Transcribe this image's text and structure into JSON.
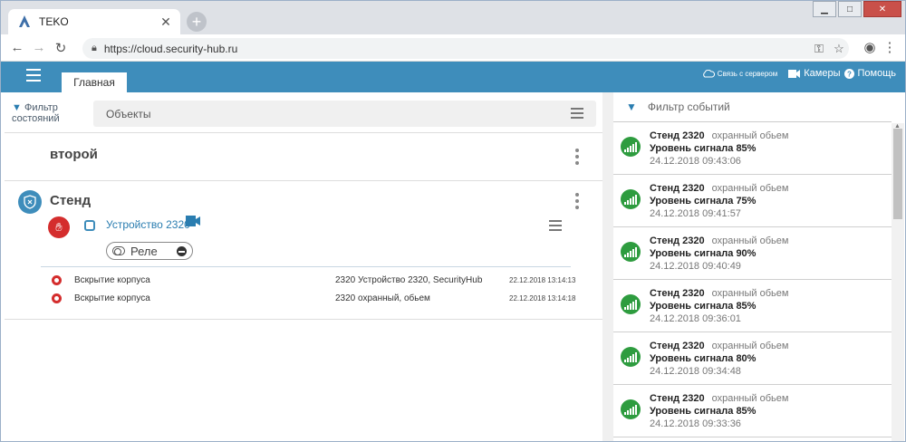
{
  "browser": {
    "tab_title": "TEKO",
    "url": "https://cloud.security-hub.ru"
  },
  "header": {
    "main_tab": "Главная",
    "sync_label": "Связь с сервером",
    "cameras_label": "Камеры",
    "help_label": "Помощь"
  },
  "left": {
    "filter_state_line1": "Фильтр",
    "filter_state_line2": "состояний",
    "objects_placeholder": "Объекты",
    "object1_name": "второй",
    "object2_name": "Стенд",
    "device_name": "Устройство 2320",
    "relay_label": "Реле",
    "events": [
      {
        "text": "Вскрытие корпуса",
        "source": "2320 Устройство 2320, SecurityHub",
        "datetime": "22.12.2018 13:14:13"
      },
      {
        "text": "Вскрытие корпуса",
        "source": "2320 охранный, обьем",
        "datetime": "22.12.2018 13:14:18"
      }
    ]
  },
  "right": {
    "filter_placeholder": "Фильтр событий",
    "events": [
      {
        "device": "Стенд 2320",
        "zone": "охранный обьем",
        "message": "Уровень сигнала 85%",
        "datetime": "24.12.2018 09:43:06"
      },
      {
        "device": "Стенд 2320",
        "zone": "охранный обьем",
        "message": "Уровень сигнала 75%",
        "datetime": "24.12.2018 09:41:57"
      },
      {
        "device": "Стенд 2320",
        "zone": "охранный обьем",
        "message": "Уровень сигнала 90%",
        "datetime": "24.12.2018 09:40:49"
      },
      {
        "device": "Стенд 2320",
        "zone": "охранный обьем",
        "message": "Уровень сигнала 85%",
        "datetime": "24.12.2018 09:36:01"
      },
      {
        "device": "Стенд 2320",
        "zone": "охранный обьем",
        "message": "Уровень сигнала 80%",
        "datetime": "24.12.2018 09:34:48"
      },
      {
        "device": "Стенд 2320",
        "zone": "охранный обьем",
        "message": "Уровень сигнала 85%",
        "datetime": "24.12.2018 09:33:36"
      }
    ]
  },
  "colors": {
    "header_blue": "#3e8dbb",
    "alarm_red": "#d42d2d",
    "signal_green": "#2e9c3f"
  }
}
